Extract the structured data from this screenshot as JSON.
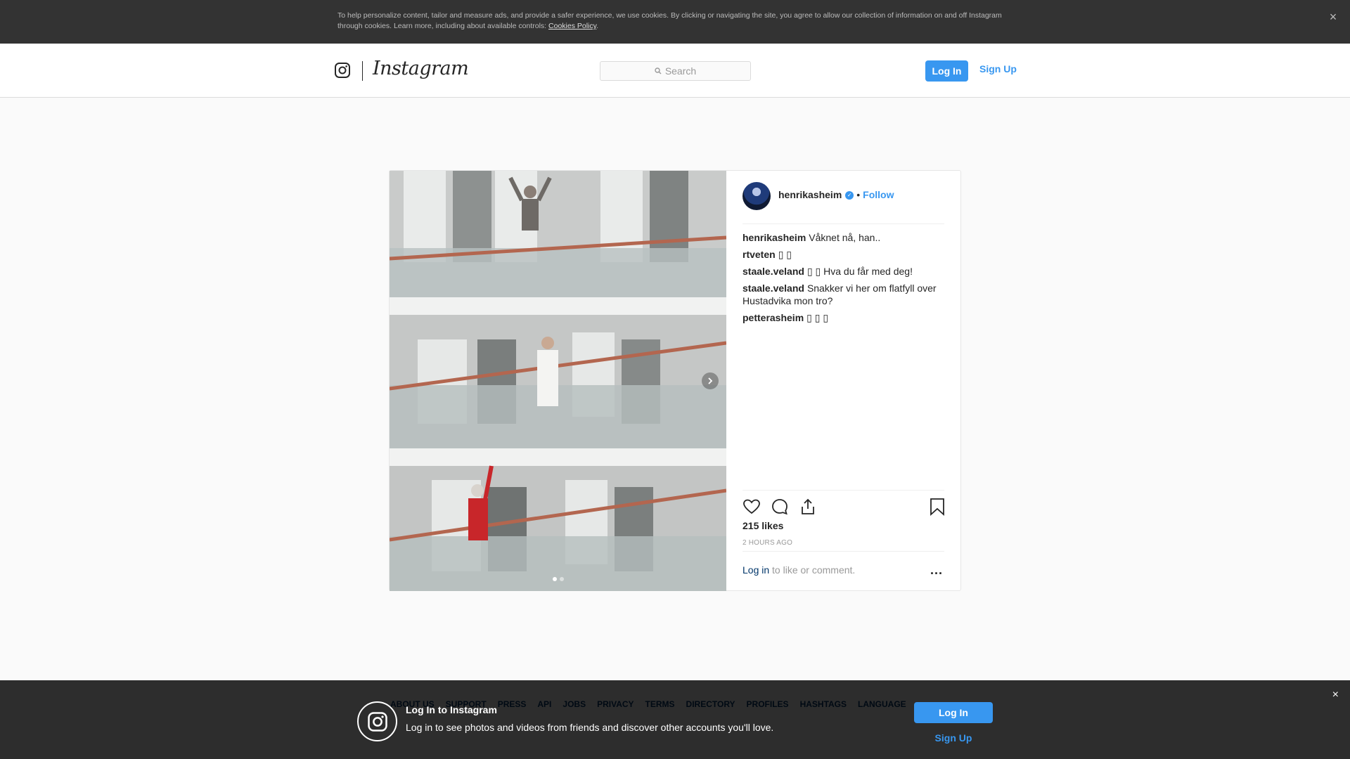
{
  "cookie": {
    "text": "To help personalize content, tailor and measure ads, and provide a safer experience, we use cookies. By clicking or navigating the site, you agree to allow our collection of information on and off Instagram through cookies. Learn more, including about available controls:",
    "link": "Cookies Policy",
    "suffix": ".",
    "close": "×"
  },
  "header": {
    "wordmark": "Instagram",
    "search_placeholder": "Search",
    "login": "Log In",
    "signup": "Sign Up",
    "icons": [
      "instagram-glyph-icon",
      "search-icon"
    ]
  },
  "post": {
    "username": "henrikasheim",
    "verified_mark": "✓",
    "bullet": "•",
    "follow": "Follow",
    "comments": [
      {
        "user": "henrikasheim",
        "text": "Våknet nå, han.."
      },
      {
        "user": "rtveten",
        "text": "▯ ▯"
      },
      {
        "user": "staale.veland",
        "text": "▯ ▯  Hva du får med deg!"
      },
      {
        "user": "staale.veland",
        "text": "Snakker vi her om flatfyll over Hustadvika mon tro?"
      },
      {
        "user": "petterasheim",
        "text": "▯ ▯ ▯"
      }
    ],
    "likes": "215 likes",
    "time": "2 HOURS AGO",
    "login_link": "Log in",
    "login_suffix": " to like or comment.",
    "more": "...",
    "carousel_slides": 2,
    "carousel_active": 1,
    "icons": [
      "heart-icon",
      "comment-icon",
      "share-icon",
      "bookmark-icon",
      "chevron-right-icon"
    ]
  },
  "footer": {
    "links": [
      "ABOUT US",
      "SUPPORT",
      "PRESS",
      "API",
      "JOBS",
      "PRIVACY",
      "TERMS",
      "DIRECTORY",
      "PROFILES",
      "HASHTAGS",
      "LANGUAGE"
    ]
  },
  "login_bar": {
    "title": "Log In to Instagram",
    "subtitle": "Log in to see photos and videos from friends and discover other accounts you'll love.",
    "login": "Log In",
    "signup": "Sign Up",
    "close": "×"
  },
  "colors": {
    "accent": "#3897f0",
    "link_dark": "#003569",
    "banner_bg": "#333333"
  }
}
